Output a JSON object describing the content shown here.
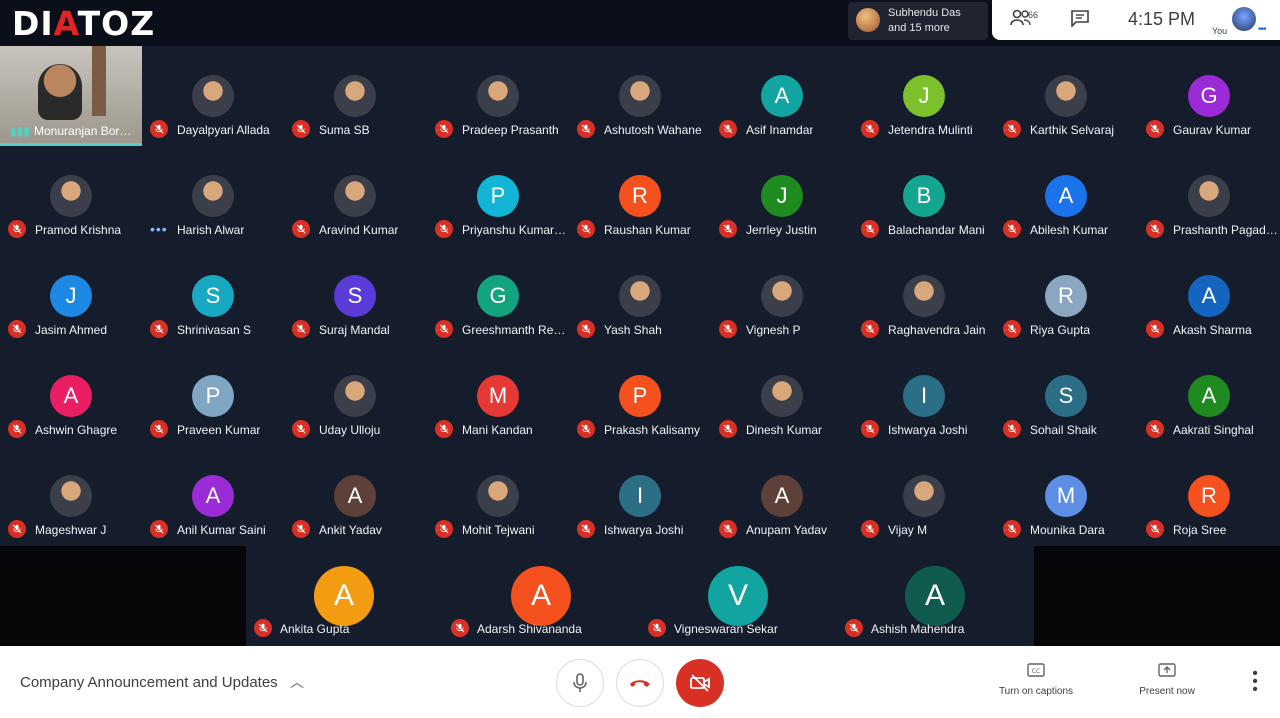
{
  "brand": {
    "logo_pre": "DI",
    "logo_accent": "A",
    "logo_post": "TOZ"
  },
  "joined": {
    "name": "Subhendu Das",
    "more": "and 15 more"
  },
  "status": {
    "people_count": "66",
    "time": "4:15 PM",
    "self_label": "You"
  },
  "presenter": {
    "name": "Monuranjan Borgohain",
    "icon": "audio-level-icon"
  },
  "participants": [
    {
      "name": "Dayalpyari Allada",
      "photo": true,
      "letter": "",
      "color": ""
    },
    {
      "name": "Suma SB",
      "photo": true,
      "letter": "",
      "color": ""
    },
    {
      "name": "Pradeep Prasanth",
      "photo": true,
      "letter": "",
      "color": ""
    },
    {
      "name": "Ashutosh Wahane",
      "photo": true,
      "letter": "",
      "color": ""
    },
    {
      "name": "Asif Inamdar",
      "photo": false,
      "letter": "A",
      "color": "#12a4a0"
    },
    {
      "name": "Jetendra Mulinti",
      "photo": false,
      "letter": "J",
      "color": "#7cc12c"
    },
    {
      "name": "Karthik Selvaraj",
      "photo": true,
      "letter": "",
      "color": ""
    },
    {
      "name": "Gaurav Kumar",
      "photo": false,
      "letter": "G",
      "color": "#9b2bd6"
    },
    {
      "name": "Pramod Krishna",
      "photo": true,
      "letter": "",
      "color": ""
    },
    {
      "name": "Harish Alwar",
      "photo": true,
      "letter": "",
      "color": "",
      "speaking": true
    },
    {
      "name": "Aravind Kumar",
      "photo": true,
      "letter": "",
      "color": ""
    },
    {
      "name": "Priyanshu Kumar Singh",
      "photo": false,
      "letter": "P",
      "color": "#13b5d6"
    },
    {
      "name": "Raushan Kumar",
      "photo": false,
      "letter": "R",
      "color": "#f4511e"
    },
    {
      "name": "Jerrley Justin",
      "photo": false,
      "letter": "J",
      "color": "#1f8a1f"
    },
    {
      "name": "Balachandar Mani",
      "photo": false,
      "letter": "B",
      "color": "#12a58f"
    },
    {
      "name": "Abilesh Kumar",
      "photo": false,
      "letter": "A",
      "color": "#1a73e8"
    },
    {
      "name": "Prashanth Pagadala",
      "photo": true,
      "letter": "",
      "color": ""
    },
    {
      "name": "Jasim Ahmed",
      "photo": false,
      "letter": "J",
      "color": "#1e88e5"
    },
    {
      "name": "Shrinivasan S",
      "photo": false,
      "letter": "S",
      "color": "#18a8c2"
    },
    {
      "name": "Suraj Mandal",
      "photo": false,
      "letter": "S",
      "color": "#5b3bd8"
    },
    {
      "name": "Greeshmanth Reddy",
      "photo": false,
      "letter": "G",
      "color": "#13a37f"
    },
    {
      "name": "Yash Shah",
      "photo": true,
      "letter": "",
      "color": ""
    },
    {
      "name": "Vignesh P",
      "photo": true,
      "letter": "",
      "color": ""
    },
    {
      "name": "Raghavendra Jain",
      "photo": true,
      "letter": "",
      "color": ""
    },
    {
      "name": "Riya Gupta",
      "photo": false,
      "letter": "R",
      "color": "#8aa6c1"
    },
    {
      "name": "Akash Sharma",
      "photo": false,
      "letter": "A",
      "color": "#1565c0"
    },
    {
      "name": "Ashwin Ghagre",
      "photo": false,
      "letter": "A",
      "color": "#e91e63"
    },
    {
      "name": "Praveen Kumar",
      "photo": false,
      "letter": "P",
      "color": "#7fa6c2"
    },
    {
      "name": "Uday Ulloju",
      "photo": true,
      "letter": "",
      "color": ""
    },
    {
      "name": "Mani Kandan",
      "photo": false,
      "letter": "M",
      "color": "#e53935"
    },
    {
      "name": "Prakash Kalisamy",
      "photo": false,
      "letter": "P",
      "color": "#f4511e"
    },
    {
      "name": "Dinesh Kumar",
      "photo": true,
      "letter": "",
      "color": ""
    },
    {
      "name": "Ishwarya Joshi",
      "photo": false,
      "letter": "I",
      "color": "#2c6e86"
    },
    {
      "name": "Sohail Shaik",
      "photo": false,
      "letter": "S",
      "color": "#2c6e86"
    },
    {
      "name": "Aakrati Singhal",
      "photo": false,
      "letter": "A",
      "color": "#1f8a1f"
    },
    {
      "name": "Mageshwar J",
      "photo": true,
      "letter": "",
      "color": ""
    },
    {
      "name": "Anil Kumar Saini",
      "photo": false,
      "letter": "A",
      "color": "#9b2bd6"
    },
    {
      "name": "Ankit Yadav",
      "photo": false,
      "letter": "A",
      "color": "#5d4037"
    },
    {
      "name": "Mohit Tejwani",
      "photo": true,
      "letter": "",
      "color": ""
    },
    {
      "name": "Ishwarya Joshi",
      "photo": false,
      "letter": "I",
      "color": "#2c6e86"
    },
    {
      "name": "Anupam Yadav",
      "photo": false,
      "letter": "A",
      "color": "#5d4037"
    },
    {
      "name": "Vijay M",
      "photo": true,
      "letter": "",
      "color": ""
    },
    {
      "name": "Mounika Dara",
      "photo": false,
      "letter": "M",
      "color": "#5c8ee6"
    },
    {
      "name": "Roja Sree",
      "photo": false,
      "letter": "R",
      "color": "#f4511e"
    }
  ],
  "bottom_row": [
    {
      "name": "Ankita Gupta",
      "letter": "A",
      "color": "#f39c12"
    },
    {
      "name": "Adarsh Shivananda",
      "letter": "A",
      "color": "#f4511e"
    },
    {
      "name": "Vigneswaran Sekar",
      "letter": "V",
      "color": "#12a4a0"
    },
    {
      "name": "Ashish Mahendra",
      "letter": "A",
      "color": "#0f5c4f"
    }
  ],
  "controls": {
    "meeting_title": "Company Announcement and Updates",
    "captions_label": "Turn on captions",
    "present_label": "Present now"
  },
  "icons": {
    "mic_off": "mic-off-icon",
    "mic": "mic-icon",
    "hangup": "hangup-icon",
    "camera_off": "camera-off-icon",
    "captions": "captions-icon",
    "present": "present-icon",
    "people": "people-icon",
    "chat": "chat-icon",
    "more": "more-vert-icon"
  },
  "colors": {
    "mic_off_red": "#d93025",
    "accent_teal": "#4fd1c5",
    "brand_red": "#e02424"
  }
}
